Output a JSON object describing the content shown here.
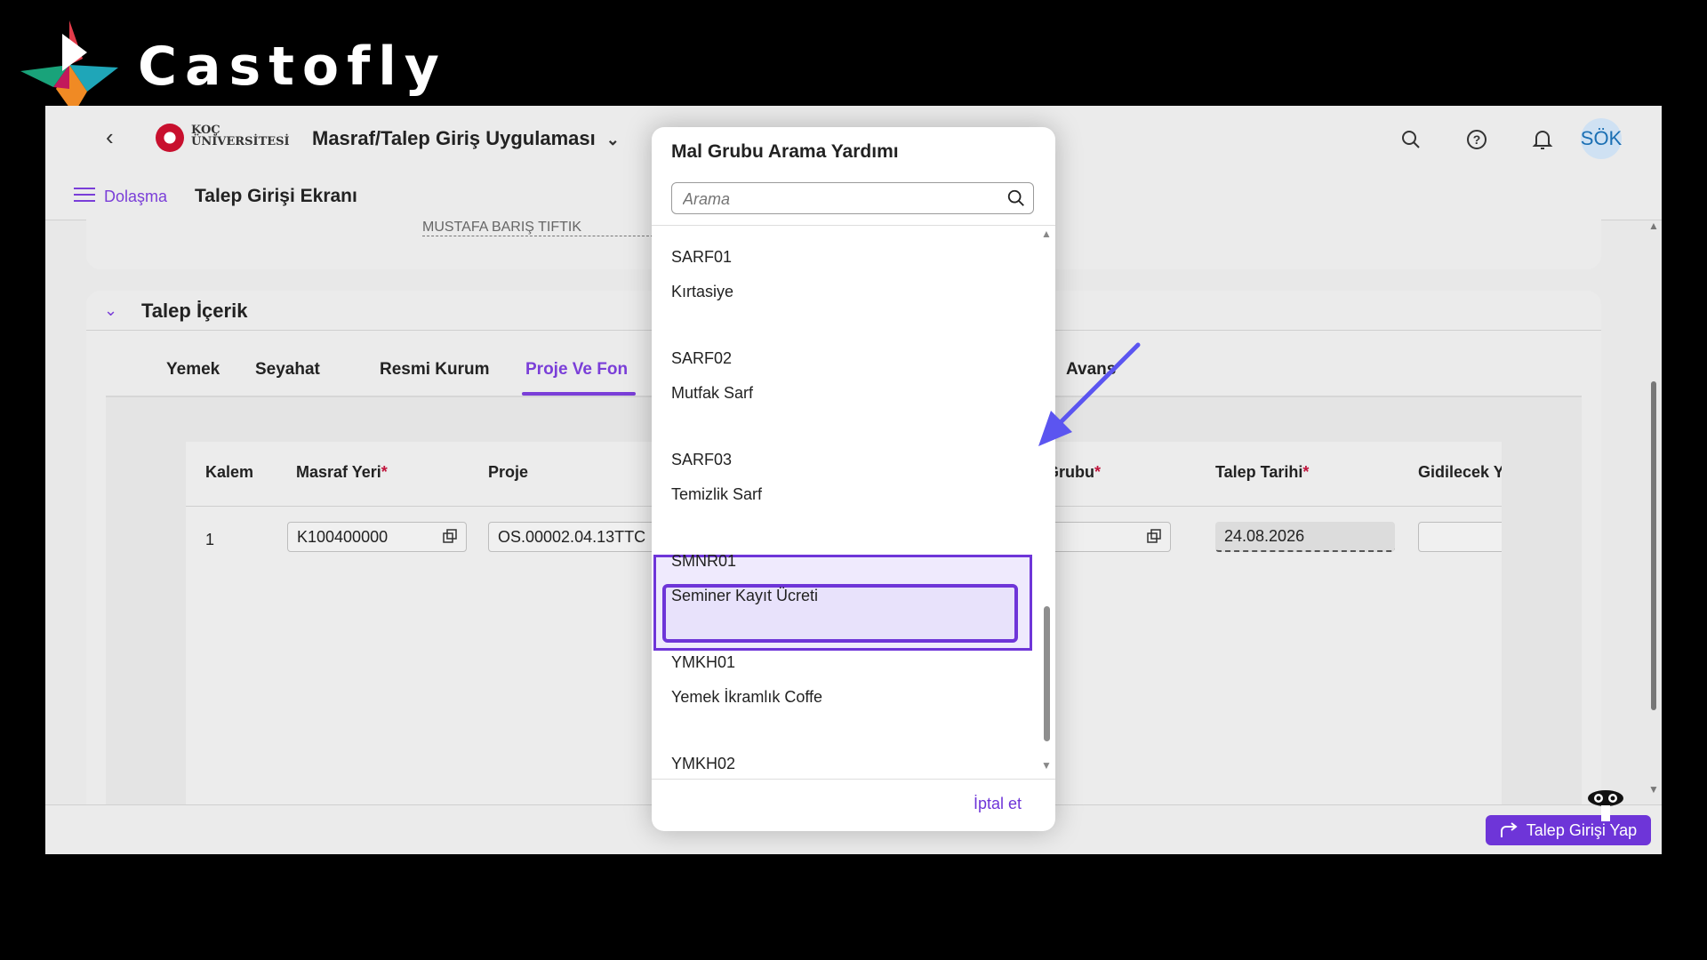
{
  "brand": {
    "name": "Castofly"
  },
  "shell": {
    "app_title": "Masraf/Talep Giriş Uygulaması",
    "logo_text_line1": "KOÇ",
    "logo_text_line2": "ÜNİVERSİTESİ",
    "avatar_initials": "SÖK"
  },
  "nav": {
    "menu_label": "Dolaşma",
    "screen_title": "Talep Girişi Ekranı"
  },
  "header_field": {
    "value": "MUSTAFA BARIŞ TIFTIK"
  },
  "section": {
    "title": "Talep İçerik"
  },
  "tabs": [
    {
      "label": "Yemek",
      "active": false
    },
    {
      "label": "Seyahat",
      "active": false
    },
    {
      "label": "Resmi Kurum",
      "active": false
    },
    {
      "label": "Proje Ve Fon",
      "active": true
    },
    {
      "label": "Avans",
      "active": false
    }
  ],
  "table": {
    "columns": [
      "Kalem",
      "Masraf Yeri",
      "Proje",
      "Grubu",
      "Talep Tarihi",
      "Gidilecek Y"
    ],
    "required_mark": "*",
    "row": {
      "kalem": "1",
      "masraf_yeri": "K100400000",
      "proje": "OS.00002.04.13TTC",
      "grubu": "",
      "talep_tarihi": "24.08.2026",
      "gidilecek": ""
    }
  },
  "footer": {
    "primary_label": "Talep Girişi Yap"
  },
  "dialog": {
    "title": "Mal Grubu Arama Yardımı",
    "search_placeholder": "Arama",
    "items": [
      {
        "code": "SARF01",
        "desc": "Kırtasiye"
      },
      {
        "code": "SARF02",
        "desc": "Mutfak Sarf"
      },
      {
        "code": "SARF03",
        "desc": "Temizlik Sarf",
        "highlighted": true
      },
      {
        "code": "SMNR01",
        "desc": "Seminer Kayıt Ücreti"
      },
      {
        "code": "YMKH01",
        "desc": "Yemek İkramlık Coffe"
      },
      {
        "code": "YMKH02",
        "desc": ""
      }
    ],
    "cancel_label": "İptal et"
  },
  "colors": {
    "accent": "#6e35d8",
    "required": "#c0143c"
  }
}
